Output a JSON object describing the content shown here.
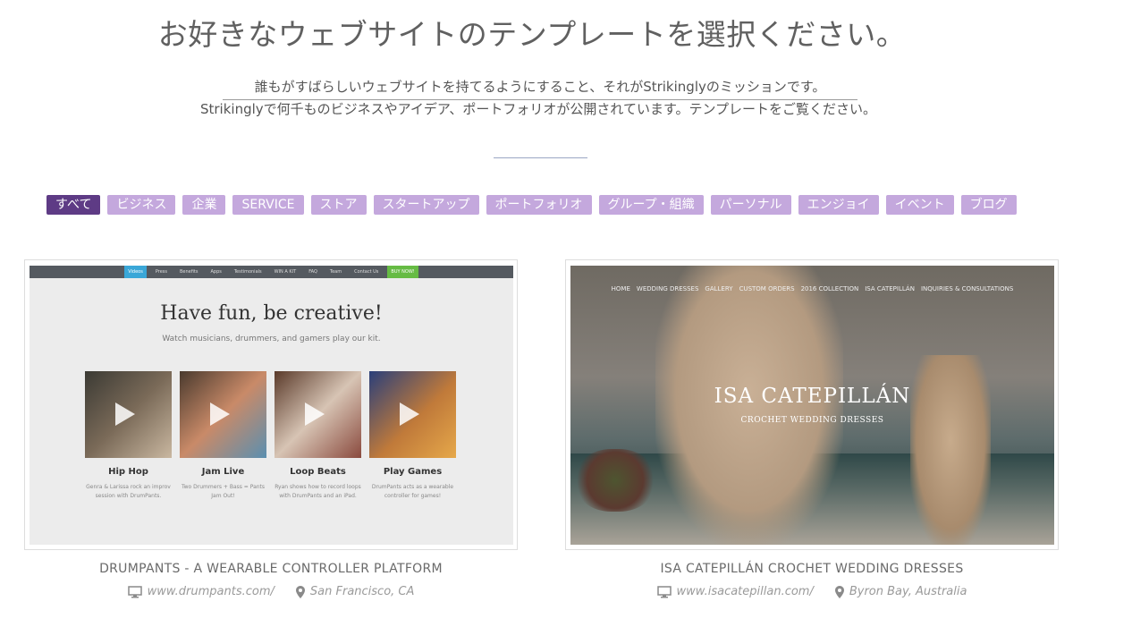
{
  "header": {
    "title": "お好きなウェブサイトのテンプレートを選択ください。",
    "subtitle_line1": "誰もがすばらしいウェブサイトを持てるようにすること、それがStrikinglyのミッションです。",
    "subtitle_line2": "Strikinglyで何千ものビジネスやアイデア、ポートフォリオが公開されています。テンプレートをご覧ください。"
  },
  "filters": [
    "すべて",
    "ビジネス",
    "企業",
    "SERVICE",
    "ストア",
    "スタートアップ",
    "ポートフォリオ",
    "グループ・組織",
    "パーソナル",
    "エンジョイ",
    "イベント",
    "ブログ"
  ],
  "active_filter": "すべて",
  "colors": {
    "chip": "#c4a8dd",
    "chip_active": "#5e3b85"
  },
  "cards": [
    {
      "title": "DRUMPANTS - A WEARABLE CONTROLLER PLATFORM",
      "url": "www.drumpants.com/",
      "location": "San Francisco, CA",
      "thumbnail": {
        "nav": [
          "Videos",
          "Press",
          "Benefits",
          "Apps",
          "Testimonials",
          "WIN A KIT",
          "FAQ",
          "Team",
          "Contact Us",
          "BUY NOW!"
        ],
        "heading": "Have fun, be creative!",
        "tagline": "Watch musicians, drummers, and gamers play our kit.",
        "tiles": [
          {
            "name": "Hip Hop",
            "desc": "Genra & Larissa rock an improv session with DrumPants."
          },
          {
            "name": "Jam Live",
            "desc": "Two Drummers + Bass = Pants Jam Out!"
          },
          {
            "name": "Loop Beats",
            "desc": "Ryan shows how to record loops with DrumPants and an iPad."
          },
          {
            "name": "Play Games",
            "desc": "DrumPants acts as a wearable controller for games!"
          }
        ]
      }
    },
    {
      "title": "ISA CATEPILLÁN CROCHET WEDDING DRESSES",
      "url": "www.isacatepillan.com/",
      "location": "Byron Bay, Australia",
      "thumbnail": {
        "nav": [
          "HOME",
          "WEDDING DRESSES",
          "GALLERY",
          "CUSTOM ORDERS",
          "2016 COLLECTION",
          "ISA CATEPILLÁN",
          "INQUIRIES & CONSULTATIONS"
        ],
        "logo": "ISA CATEPILLÁN",
        "logo_sub": "CROCHET WEDDING DRESSES"
      }
    }
  ]
}
